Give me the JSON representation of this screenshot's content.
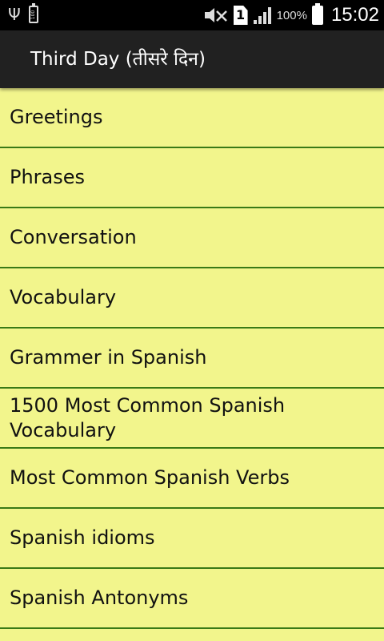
{
  "status_bar": {
    "battery_small_label": "100",
    "sim_label": "1",
    "battery_percent": "100%",
    "time": "15:02",
    "icons": [
      "usb-icon",
      "battery-icon",
      "mute-icon",
      "sim-icon",
      "signal-icon",
      "battery-icon"
    ]
  },
  "action_bar": {
    "title": "Third Day (तीसरे दिन)"
  },
  "menu": {
    "items": [
      {
        "label": "Greetings"
      },
      {
        "label": "Phrases"
      },
      {
        "label": "Conversation"
      },
      {
        "label": "Vocabulary"
      },
      {
        "label": "Grammer in Spanish"
      },
      {
        "label": "1500 Most Common Spanish Vocabulary"
      },
      {
        "label": "Most Common Spanish Verbs"
      },
      {
        "label": "Spanish idioms"
      },
      {
        "label": "Spanish Antonyms"
      }
    ]
  },
  "colors": {
    "background": "#f2f58c",
    "divider": "#3a7a16",
    "action_bar": "#212121",
    "status_bar": "#000000"
  }
}
